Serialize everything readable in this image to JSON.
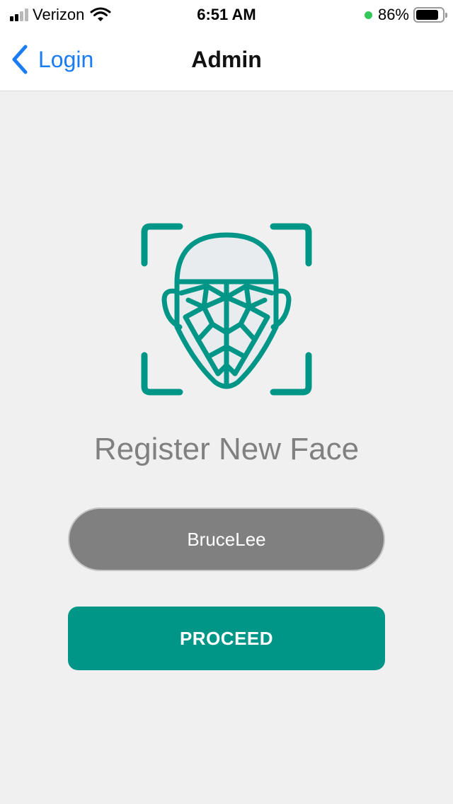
{
  "status_bar": {
    "carrier": "Verizon",
    "time": "6:51 AM",
    "battery": "86%",
    "battery_level": 0.86,
    "icons": [
      "signal-icon",
      "wifi-icon",
      "battery-icon"
    ]
  },
  "nav": {
    "back_label": "Login",
    "title": "Admin"
  },
  "main": {
    "graphic": "face-scan-icon",
    "heading": "Register New Face",
    "name_value": "BruceLee",
    "proceed_label": "PROCEED"
  },
  "colors": {
    "accent": "#009687",
    "link": "#1a7cf5",
    "field_bg": "#808080",
    "page_bg": "#f0f0f0"
  }
}
